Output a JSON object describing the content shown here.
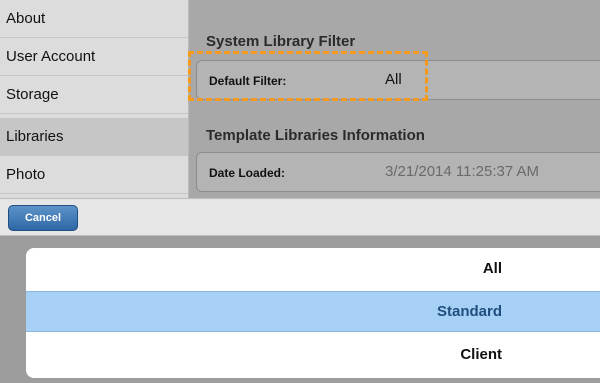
{
  "sidebar": {
    "items": [
      {
        "label": "About"
      },
      {
        "label": "User Account"
      },
      {
        "label": "Storage"
      },
      {
        "label": "Libraries"
      },
      {
        "label": "Photo"
      }
    ]
  },
  "system_filter": {
    "title": "System Library Filter",
    "label": "Default Filter:",
    "value": "All"
  },
  "template_info": {
    "title": "Template Libraries Information",
    "label": "Date Loaded:",
    "value": "3/21/2014 11:25:37 AM"
  },
  "action_sheet": {
    "cancel_label": "Cancel",
    "options": [
      {
        "label": "All"
      },
      {
        "label": "Standard"
      },
      {
        "label": "Client"
      }
    ],
    "selected": "Standard"
  },
  "colors": {
    "highlight": "#f59a1b",
    "selected_option": "#a6d0f5",
    "cancel_button": "#2d67a5"
  }
}
